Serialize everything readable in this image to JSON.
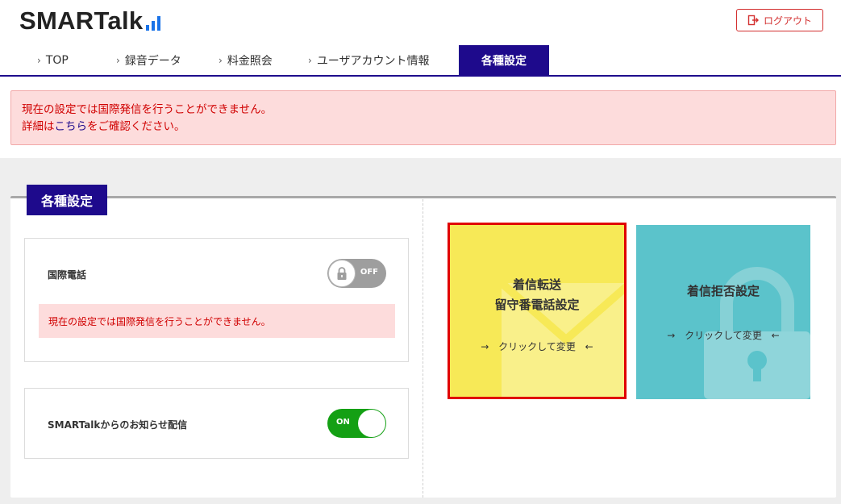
{
  "header": {
    "logo_text": "SMARTalk",
    "logout_label": "ログアウト"
  },
  "nav": {
    "items": [
      {
        "label": "TOP"
      },
      {
        "label": "録音データ"
      },
      {
        "label": "料金照会"
      },
      {
        "label": "ユーザアカウント情報"
      },
      {
        "label": "各種設定",
        "active": true
      }
    ]
  },
  "alert": {
    "line1": "現在の設定では国際発信を行うことができません。",
    "line2_prefix": "詳細は",
    "line2_link": "こちら",
    "line2_suffix": "をご確認ください。"
  },
  "panel": {
    "title": "各種設定",
    "international": {
      "label": "国際電話",
      "toggle_state": "OFF",
      "warning": "現在の設定では国際発信を行うことができません。"
    },
    "newsletter": {
      "label": "SMARTalkからのお知らせ配信",
      "toggle_state": "ON"
    },
    "tiles": {
      "forward": {
        "title_line1": "着信転送",
        "title_line2": "留守番電話設定",
        "action": "クリックして変更"
      },
      "reject": {
        "title": "着信拒否設定",
        "action": "クリックして変更"
      }
    }
  },
  "colors": {
    "brand_navy": "#1e0a8c",
    "alert_red": "#d00000",
    "alert_bg": "#fddcdc",
    "toggle_on": "#14a014",
    "tile_yellow": "#f7e957",
    "tile_teal": "#5bc3cb",
    "highlight_border": "#e00000"
  },
  "icons": {
    "logout": "logout-icon",
    "lock": "lock-icon",
    "envelope": "envelope-icon",
    "chevron": "chevron-right-icon",
    "arrow_right": "arrow-right-icon",
    "arrow_left": "arrow-left-icon",
    "signal_bars": "signal-bars-icon"
  }
}
